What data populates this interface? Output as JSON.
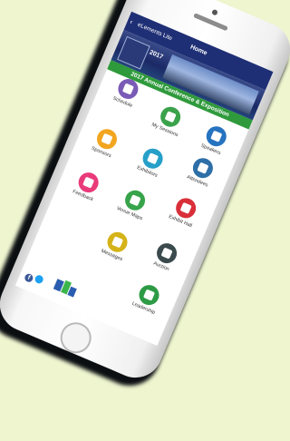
{
  "nav": {
    "back_label": "eLements Lite",
    "title": "Home"
  },
  "banner": {
    "year": "2017",
    "event_title": "2017 Annual Conference & Exposition"
  },
  "tiles": [
    {
      "label": "Schedule",
      "icon": "schedule-icon",
      "color": "#7a5bb6"
    },
    {
      "label": "My Sessions",
      "icon": "bookmark-icon",
      "color": "#3aa24a"
    },
    {
      "label": "Attendees",
      "icon": "people-icon",
      "color": "#2e6fa7"
    },
    {
      "label": "Exhibitors",
      "icon": "chat-icon",
      "color": "#26a0c8"
    },
    {
      "label": "Speakers",
      "icon": "clipboard-icon",
      "color": "#2673c0"
    },
    {
      "label": "Sponsors",
      "icon": "folder-icon",
      "color": "#f2a51f"
    },
    {
      "label": "Venue Maps",
      "icon": "map-pin-icon",
      "color": "#37a34a"
    },
    {
      "label": "Exhibit Hall",
      "icon": "handshake-icon",
      "color": "#d92f3a"
    },
    {
      "label": "Feedback",
      "icon": "star-icon",
      "color": "#e93a7a"
    },
    {
      "label": "Auction",
      "icon": "hammer-icon",
      "color": "#3b4a4c"
    },
    {
      "label": "Messages",
      "icon": "play-icon",
      "color": "#d5b318"
    },
    {
      "label": "Leadership",
      "icon": "person-icon",
      "color": "#2d9b45"
    }
  ]
}
